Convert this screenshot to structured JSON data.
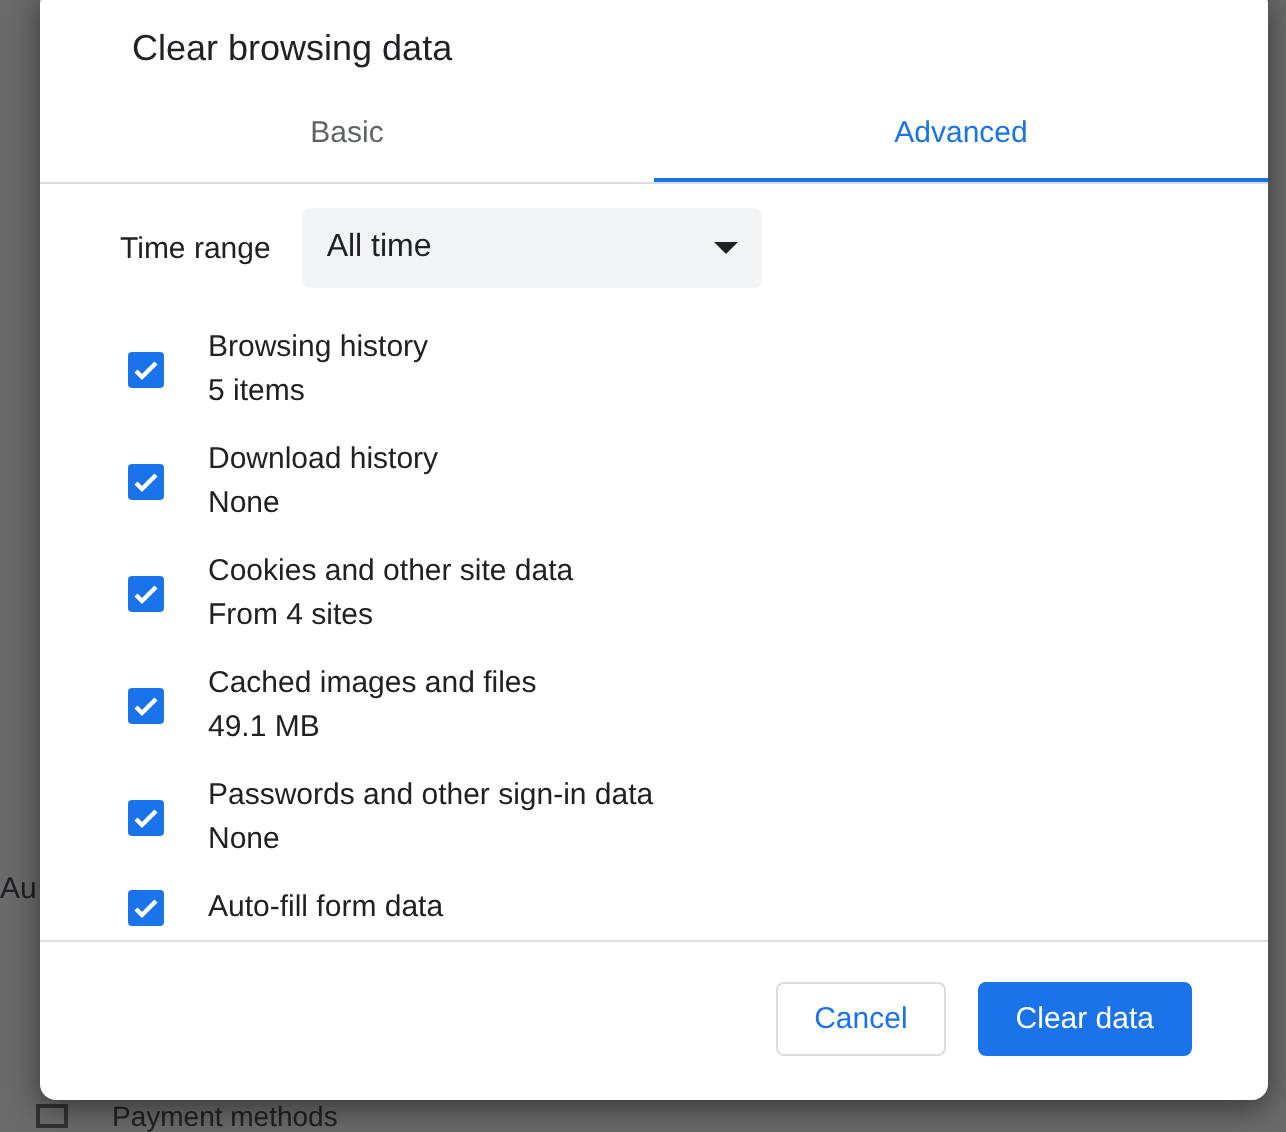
{
  "background": {
    "label": "Au",
    "row_label": "Payment methods"
  },
  "dialog": {
    "title": "Clear browsing data",
    "tabs": [
      {
        "label": "Basic",
        "selected": false
      },
      {
        "label": "Advanced",
        "selected": true
      }
    ],
    "time_range": {
      "label": "Time range",
      "value": "All time"
    },
    "items": [
      {
        "title": "Browsing history",
        "detail": "5 items",
        "checked": true
      },
      {
        "title": "Download history",
        "detail": "None",
        "checked": true
      },
      {
        "title": "Cookies and other site data",
        "detail": "From 4 sites",
        "checked": true
      },
      {
        "title": "Cached images and files",
        "detail": "49.1 MB",
        "checked": true
      },
      {
        "title": "Passwords and other sign-in data",
        "detail": "None",
        "checked": true
      },
      {
        "title": "Auto-fill form data",
        "checked": true
      }
    ],
    "buttons": [
      {
        "label": "Cancel",
        "kind": "secondary"
      },
      {
        "label": "Clear data",
        "kind": "primary"
      }
    ]
  }
}
